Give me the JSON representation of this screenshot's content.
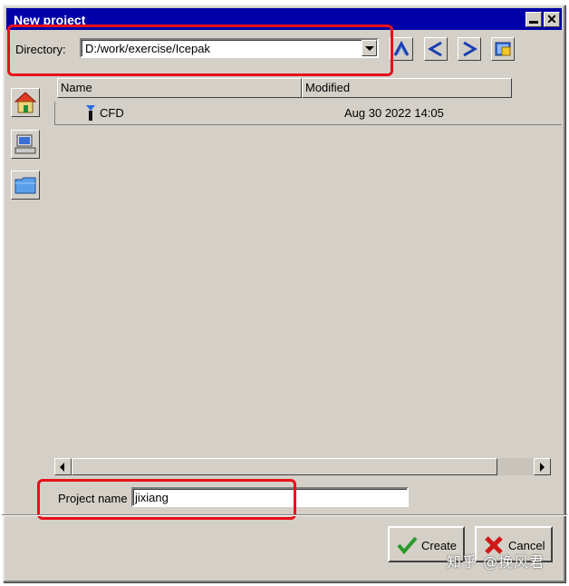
{
  "window": {
    "title": "New project"
  },
  "directory": {
    "label": "Directory:",
    "value": "D:/work/exercise/Icepak"
  },
  "nav_buttons": [
    "up-icon",
    "back-icon",
    "forward-icon",
    "new-folder-icon"
  ],
  "side_buttons": [
    "home-icon",
    "computer-icon",
    "folder-icon"
  ],
  "file_list": {
    "columns": [
      "Name",
      "Modified"
    ],
    "rows": [
      {
        "name": "CFD",
        "modified": "Aug 30 2022 14:05",
        "icon": "cfd-icon"
      }
    ]
  },
  "project_name": {
    "label": "Project name",
    "value": "jixiang"
  },
  "buttons": {
    "create": "Create",
    "cancel": "Cancel"
  },
  "watermark": "知乎 @挽风君",
  "colors": {
    "title_bar": "#0000a8",
    "dialog_bg": "#d4d0c8",
    "highlight_box": "#e8101a"
  }
}
